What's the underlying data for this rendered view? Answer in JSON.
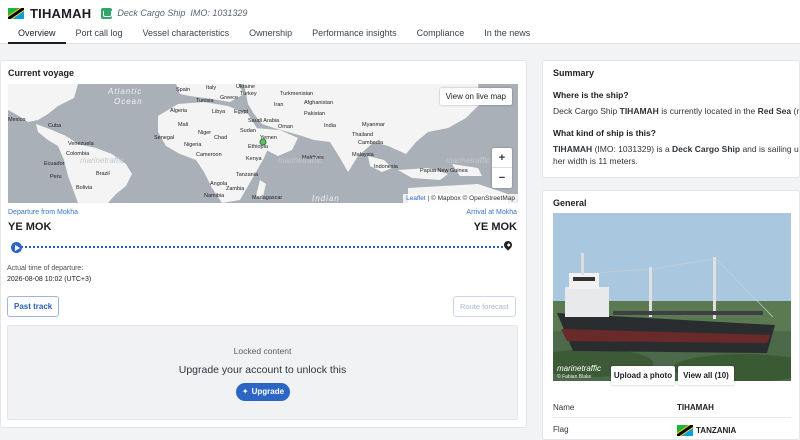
{
  "header": {
    "ship_name": "TIHAMAH",
    "ship_type": "Deck Cargo Ship",
    "imo": "IMO: 1031329",
    "flag_icon": "tanzania-flag-icon",
    "tabs": [
      {
        "label": "Overview",
        "active": true
      },
      {
        "label": "Port call log"
      },
      {
        "label": "Vessel characteristics"
      },
      {
        "label": "Ownership"
      },
      {
        "label": "Performance insights"
      },
      {
        "label": "Compliance"
      },
      {
        "label": "In the news"
      }
    ]
  },
  "voyage": {
    "title": "Current voyage",
    "map": {
      "live_button": "View on live map",
      "zoom_in": "+",
      "zoom_out": "−",
      "attribution_leaflet": "Leaflet",
      "attribution_rest": " | © Mapbox © OpenStreetMap",
      "watermark": "marinetraffic",
      "ocean_labels": [
        "Atlantic",
        "Ocean",
        "Indian"
      ],
      "labels": [
        "Spain",
        "Italy",
        "Ukraine",
        "Turkey",
        "Turkmenistan",
        "Tunisia",
        "Greece",
        "Iran",
        "Afghanistan",
        "Algeria",
        "Libya",
        "Egypt",
        "Pakistan",
        "Mexico",
        "Cuba",
        "Mali",
        "Niger",
        "Saudi Arabia",
        "Oman",
        "India",
        "Myanmar",
        "Senegal",
        "Chad",
        "Sudan",
        "Yemen",
        "Thailand",
        "Cambodia",
        "Venezuela",
        "Nigeria",
        "Ethiopia",
        "Maldives",
        "Malaysia",
        "Colombia",
        "Cameroon",
        "Kenya",
        "Indonesia",
        "Ecuador",
        "Peru",
        "Brazil",
        "Angola",
        "Tanzania",
        "Papua New Guinea",
        "Bolivia",
        "Zambia",
        "Namibia",
        "Madagascar"
      ]
    },
    "departure_label": "Departure from Mokha",
    "arrival_label": "Arrival at Mokha",
    "departure_port": "YE MOK",
    "arrival_port": "YE MOK",
    "atd_label": "Actual time of departure:",
    "atd_value": "2026-08-08 10:02 (UTC+3)",
    "past_track": "Past track",
    "route_forecast": "Route forecast",
    "locked": {
      "label": "Locked content",
      "message": "Upgrade your account to unlock this",
      "button": "Upgrade"
    }
  },
  "summary": {
    "title": "Summary",
    "q1": "Where is the ship?",
    "a1_pre": "Deck Cargo Ship ",
    "a1_name": "TIHAMAH",
    "a1_mid": " is currently located in the ",
    "a1_loc": "Red Sea",
    "a1_post": " (rep",
    "q2": "What kind of ship is this?",
    "a2_name": "TIHAMAH",
    "a2_mid": " (IMO: 1031329) is a ",
    "a2_type": "Deck Cargo Ship",
    "a2_post": " and is sailing und",
    "a2_line2": "her width is 11 meters."
  },
  "general": {
    "title": "General",
    "photo_watermark": "marinetraffic",
    "photo_credit": "© Fabian Blake",
    "upload_button": "Upload a photo",
    "view_all_button": "View all (10)",
    "name_label": "Name",
    "name_value": "TIHAMAH",
    "flag_label": "Flag",
    "flag_value": "TANZANIA"
  }
}
